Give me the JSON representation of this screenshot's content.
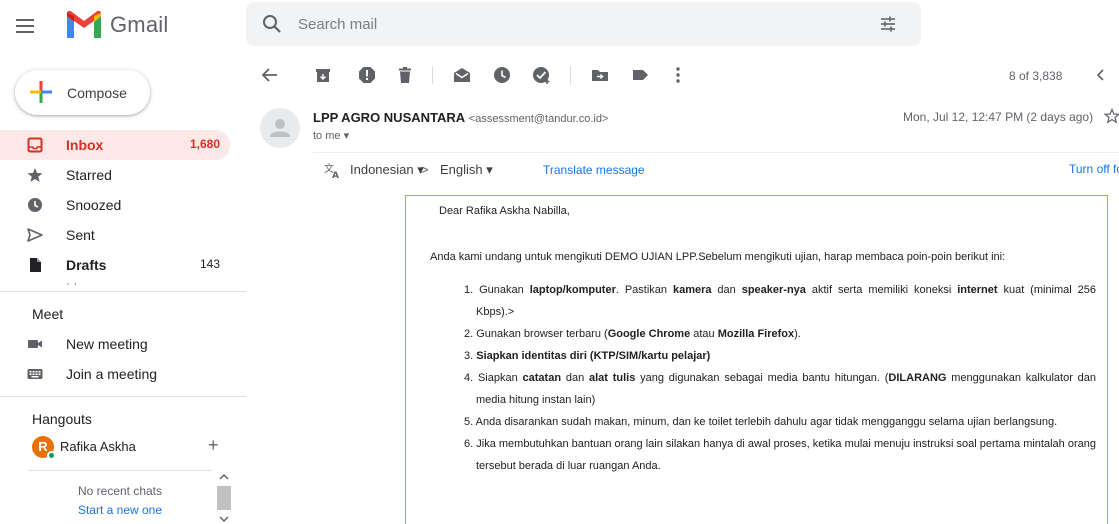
{
  "app": {
    "brand": "Gmail"
  },
  "search": {
    "placeholder": "Search mail"
  },
  "compose": {
    "label": "Compose"
  },
  "sidebar": {
    "items": [
      {
        "label": "Inbox",
        "count": "1,680"
      },
      {
        "label": "Starred",
        "count": ""
      },
      {
        "label": "Snoozed",
        "count": ""
      },
      {
        "label": "Sent",
        "count": ""
      },
      {
        "label": "Drafts",
        "count": "143"
      }
    ]
  },
  "meet": {
    "title": "Meet",
    "new_meeting": "New meeting",
    "join_meeting": "Join a meeting"
  },
  "hangouts": {
    "title": "Hangouts",
    "user_initial": "R",
    "user_name": "Rafika Askha",
    "no_recent": "No recent chats",
    "start_new": "Start a new one"
  },
  "toolbar": {
    "pager": "8 of 3,838"
  },
  "email": {
    "sender_name": "LPP AGRO NUSANTARA",
    "sender_email": "<assessment@tandur.co.id>",
    "to": "to me",
    "date": "Mon, Jul 12, 12:47 PM (2 days ago)"
  },
  "translate": {
    "from": "Indonesian",
    "arrow": ">",
    "to": "English",
    "link": "Translate message",
    "off": "Turn off for: I"
  },
  "body": {
    "greeting": "Dear Rafika Askha Nabilla,",
    "intro": "Anda kami undang untuk mengikuti DEMO UJIAN LPP.Sebelum mengikuti ujian, harap membaca poin-poin berikut ini:",
    "items": [
      {
        "num": "1.",
        "parts": [
          {
            "t": "Gunakan ",
            "b": false
          },
          {
            "t": "laptop/komputer",
            "b": true
          },
          {
            "t": ". Pastikan ",
            "b": false
          },
          {
            "t": "kamera",
            "b": true
          },
          {
            "t": " dan ",
            "b": false
          },
          {
            "t": "speaker-nya",
            "b": true
          },
          {
            "t": " aktif serta memiliki koneksi ",
            "b": false
          },
          {
            "t": "internet",
            "b": true
          },
          {
            "t": " kuat (minimal 256 Kbps).>",
            "b": false
          }
        ]
      },
      {
        "num": "2.",
        "parts": [
          {
            "t": "Gunakan browser terbaru (",
            "b": false
          },
          {
            "t": "Google Chrome",
            "b": true
          },
          {
            "t": " atau ",
            "b": false
          },
          {
            "t": "Mozilla Firefox",
            "b": true
          },
          {
            "t": ").",
            "b": false
          }
        ]
      },
      {
        "num": "3.",
        "parts": [
          {
            "t": "Siapkan identitas diri (KTP/SIM/kartu pelajar)",
            "b": true
          }
        ]
      },
      {
        "num": "4.",
        "parts": [
          {
            "t": "Siapkan ",
            "b": false
          },
          {
            "t": "catatan",
            "b": true
          },
          {
            "t": " dan ",
            "b": false
          },
          {
            "t": "alat tulis",
            "b": true
          },
          {
            "t": " yang digunakan sebagai media bantu hitungan. (",
            "b": false
          },
          {
            "t": "DILARANG",
            "b": true
          },
          {
            "t": " menggunakan kalkulator dan media hitung instan lain)",
            "b": false
          }
        ]
      },
      {
        "num": "5.",
        "parts": [
          {
            "t": "Anda disarankan sudah makan, minum, dan ke toilet terlebih dahulu agar tidak mengganggu selama ujian berlangsung.",
            "b": false
          }
        ]
      },
      {
        "num": "6.",
        "parts": [
          {
            "t": "Jika membutuhkan bantuan orang lain silakan hanya di awal proses, ketika mulai menuju instruksi soal pertama mintalah orang tersebut berada di luar ruangan Anda.",
            "b": false
          }
        ]
      }
    ]
  },
  "colors": {
    "accent_red": "#d93025",
    "active_bg": "#fce8e6",
    "link_blue": "#1a73e8",
    "body_border": "#8bc34a"
  }
}
